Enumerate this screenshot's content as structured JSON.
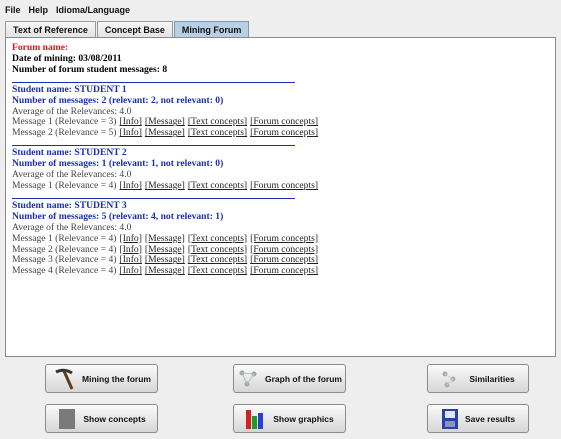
{
  "menu": [
    "File",
    "Help",
    "Idioma/Language"
  ],
  "tabs": [
    {
      "label": "Text of Reference",
      "active": false
    },
    {
      "label": "Concept Base",
      "active": false
    },
    {
      "label": "Mining Forum",
      "active": true
    }
  ],
  "report": {
    "forum_name_label": "Forum name:",
    "date_line": "Date of mining: 03/08/2011",
    "count_line": "Number of forum student messages: 8",
    "students": [
      {
        "name": "Student name: STUDENT 1",
        "messages_line": "Number of messages: 2 (relevant: 2, not relevant: 0)",
        "average": "Average of the Relevances: 4.0",
        "messages": [
          "Message 1 (Relevance = 3)",
          "Message 2 (Relevance = 5)"
        ]
      },
      {
        "name": "Student name: STUDENT 2",
        "messages_line": "Number of messages: 1 (relevant: 1, not relevant: 0)",
        "average": "Average of the Relevances: 4.0",
        "messages": [
          "Message 1 (Relevance = 4)"
        ]
      },
      {
        "name": "Student name: STUDENT 3",
        "messages_line": "Number of messages: 5 (relevant: 4, not relevant: 1)",
        "average": "Average of the Relevances: 4.0",
        "messages": [
          "Message 1 (Relevance = 4)",
          "Message 2 (Relevance = 4)",
          "Message 3 (Relevance = 4)",
          "Message 4 (Relevance = 4)"
        ]
      }
    ],
    "links": [
      "[Info]",
      "[Message]",
      "[Text concepts]",
      "[Forum concepts]"
    ]
  },
  "buttons": {
    "mining": "Mining the forum",
    "graph": "Graph of the forum",
    "similarities": "Similarities",
    "concepts": "Show  concepts",
    "graphics": "Show  graphics",
    "save": "Save results"
  },
  "icons": {
    "mining": "pickaxe-icon",
    "graph": "graph-icon",
    "similarities": "similarity-icon",
    "concepts": "concepts-icon",
    "graphics": "bar-graphics-icon",
    "save": "save-disk-icon"
  },
  "colors": {
    "forum_label": "#d21818",
    "student_heading": "#1a2fb0",
    "active_tab": "#b8cfe5"
  }
}
